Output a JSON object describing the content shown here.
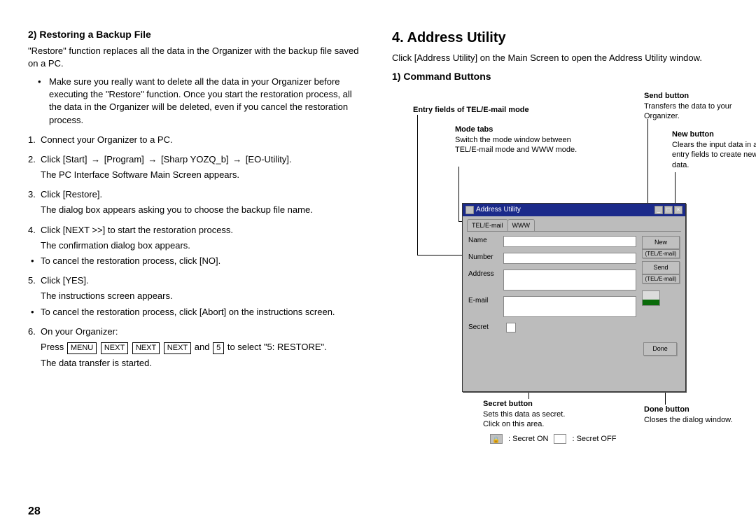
{
  "page_number": "28",
  "left": {
    "heading": "2) Restoring a Backup File",
    "intro": "\"Restore\" function replaces all the data in the Organizer with the backup file saved on a PC.",
    "caution": "Make sure you really want to delete all the data in your Organizer before executing the \"Restore\" function. Once you start the restoration process, all the data in the Organizer will be deleted, even if you cancel the restoration process.",
    "steps": {
      "s1": "Connect your Organizer to a PC.",
      "s2a": "Click [Start] ",
      "s2b": " [Program] ",
      "s2c": " [Sharp YOZQ_b] ",
      "s2d": " [EO-Utility].",
      "s2_sub": "The PC Interface Software Main Screen appears.",
      "s3": "Click [Restore].",
      "s3_sub": "The dialog box appears asking you to choose the backup file name.",
      "s4": "Click [NEXT >>] to start the restoration process.",
      "s4_sub": "The confirmation dialog box appears.",
      "s4_bullet": "To cancel the restoration process, click [NO].",
      "s5": "Click [YES].",
      "s5_sub": "The instructions screen appears.",
      "s5_bullet": "To cancel the restoration process, click [Abort] on the instructions screen.",
      "s6": "On your Organizer:",
      "s6_a": "Press ",
      "s6_keys": [
        "MENU",
        "NEXT",
        "NEXT",
        "NEXT"
      ],
      "s6_b": " and ",
      "s6_key5": "5",
      "s6_c": " to select \"5: RESTORE\".",
      "s6_sub": "The data transfer is started."
    }
  },
  "right": {
    "main_heading": "4. Address Utility",
    "intro": "Click [Address Utility] on the Main Screen to open the Address Utility window.",
    "sub_heading": "1) Command Buttons",
    "callouts": {
      "entry_title": "Entry fields of TEL/E-mail mode",
      "mode_title": "Mode tabs",
      "mode_desc": "Switch the mode window between TEL/E-mail mode and WWW mode.",
      "send_title": "Send button",
      "send_desc": "Transfers the data to your Organizer.",
      "new_title": "New button",
      "new_desc": "Clears the input data in all entry fields to create new data.",
      "secret_title": "Secret button",
      "secret_desc": "Sets this data as secret. Click on this area.",
      "done_title": "Done button",
      "done_desc": "Closes the dialog window."
    },
    "dialog": {
      "title": "Address Utility",
      "tab1": "TEL/E-mail",
      "tab2": "WWW",
      "labels": {
        "name": "Name",
        "number": "Number",
        "address": "Address",
        "email": "E-mail",
        "secret": "Secret"
      },
      "buttons": {
        "new": "New",
        "new_sub": "(TEL/E-mail)",
        "send": "Send",
        "send_sub": "(TEL/E-mail)",
        "done": "Done"
      }
    },
    "legend": {
      "on": ": Secret ON",
      "off": ": Secret OFF"
    }
  }
}
